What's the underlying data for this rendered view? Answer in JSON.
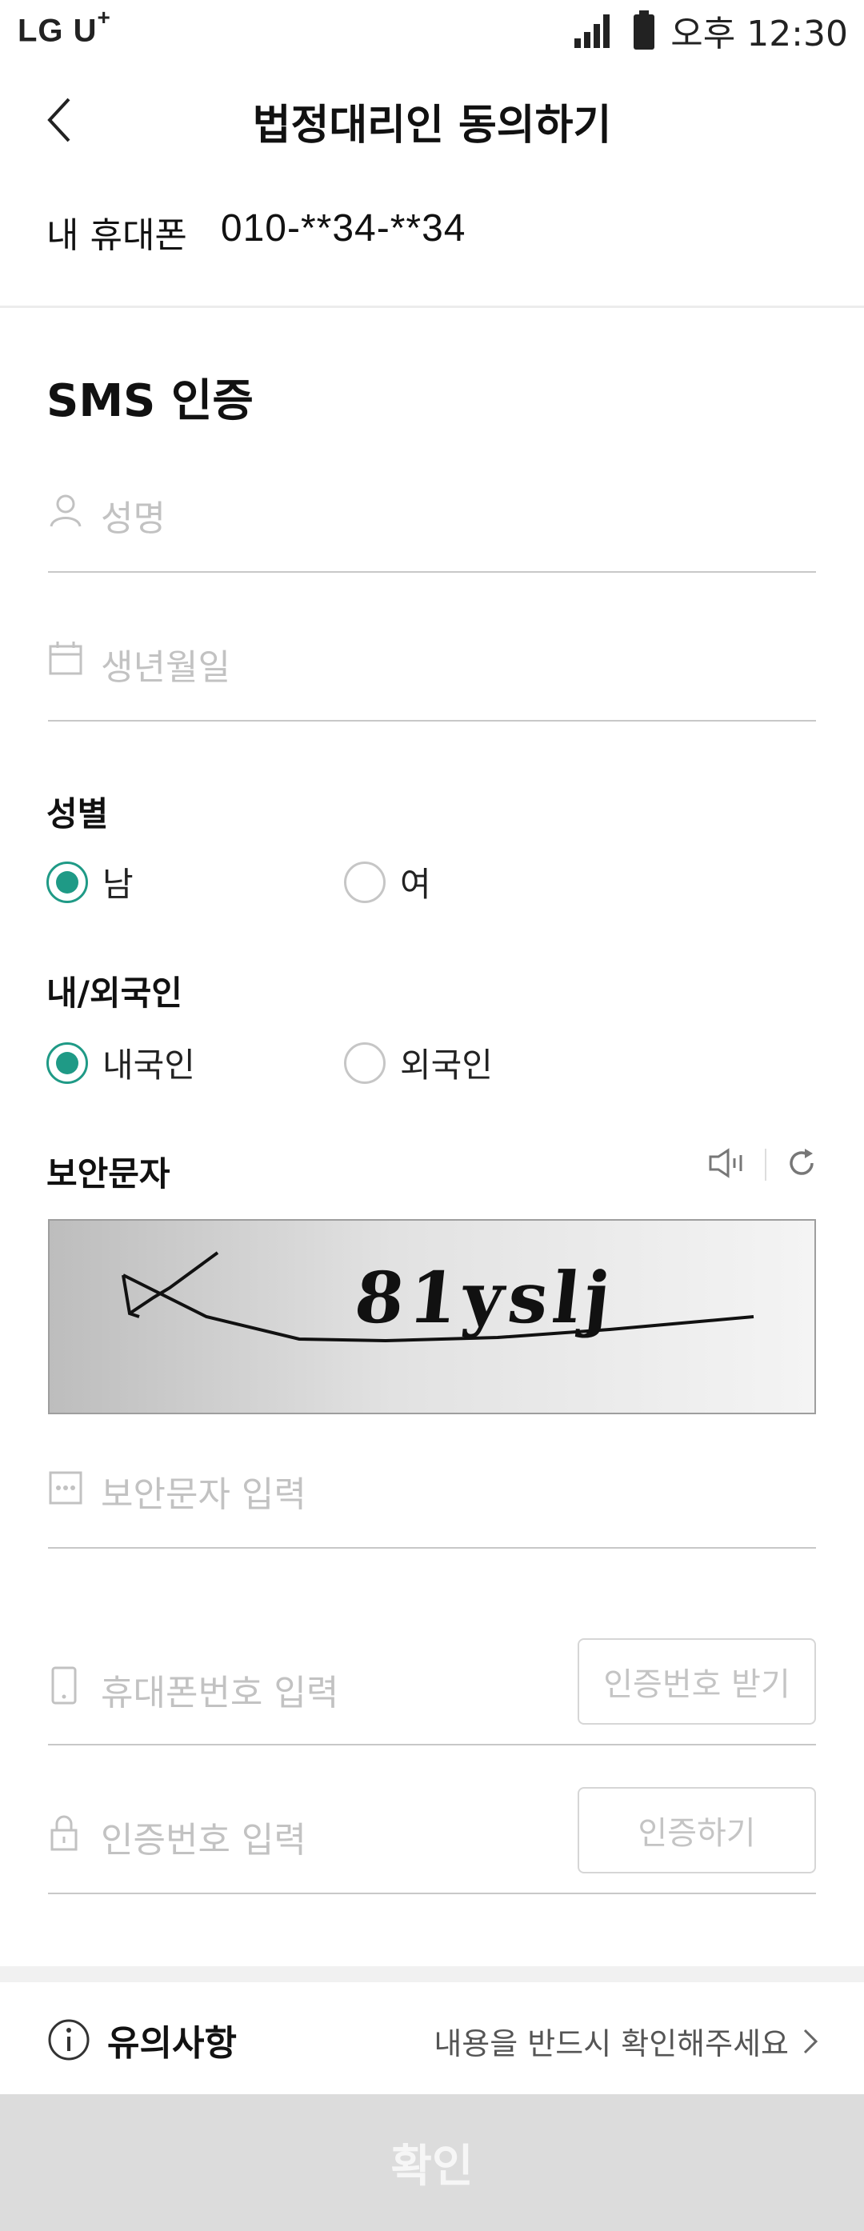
{
  "status_bar": {
    "carrier": "LG U",
    "carrier_plus": "+",
    "time": "오후 12:30"
  },
  "header": {
    "title": "법정대리인 동의하기"
  },
  "phone": {
    "label": "내 휴대폰",
    "number": "010-**34-**34"
  },
  "section": {
    "title": "SMS 인증"
  },
  "fields": {
    "name_placeholder": "성명",
    "birth_placeholder": "생년월일",
    "captcha_placeholder": "보안문자 입력",
    "mobile_placeholder": "휴대폰번호 입력",
    "code_placeholder": "인증번호 입력"
  },
  "gender": {
    "label": "성별",
    "options": [
      "남",
      "여"
    ],
    "selected": "남"
  },
  "nationality": {
    "label": "내/외국인",
    "options": [
      "내국인",
      "외국인"
    ],
    "selected": "내국인"
  },
  "captcha": {
    "label": "보안문자",
    "text": "81yslj"
  },
  "buttons": {
    "request_code": "인증번호 받기",
    "verify": "인증하기",
    "confirm": "확인"
  },
  "notice": {
    "title": "유의사항",
    "link": "내용을 반드시 확인해주세요"
  },
  "colors": {
    "accent": "#1f9a86",
    "disabled_button": "#dcdcdc",
    "placeholder": "#c2c2c2"
  }
}
